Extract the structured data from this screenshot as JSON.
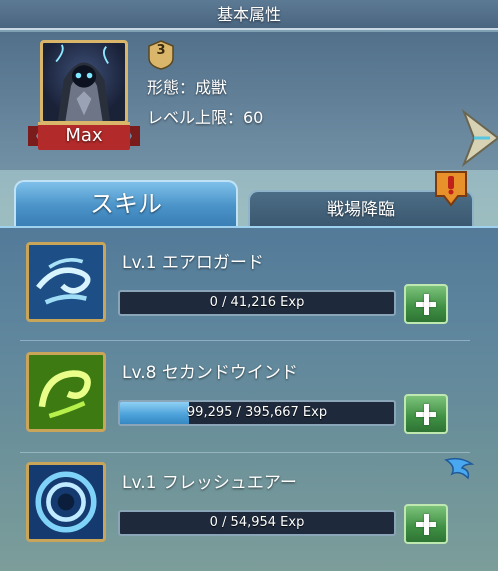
{
  "header": {
    "title": "基本属性"
  },
  "hero": {
    "level_badge": "Max",
    "rank": "3",
    "form_line": "形態：成獣",
    "level_cap_line": "レベル上限：60"
  },
  "tabs": [
    {
      "label": "スキル",
      "active": true
    },
    {
      "label": "戦場降臨",
      "active": false
    }
  ],
  "skills": [
    {
      "name": "Lv.1 エアロガード",
      "exp_text": "0 / 41,216 Exp",
      "exp_fraction": 0,
      "icon": "wind-swirl-icon"
    },
    {
      "name": "Lv.8 セカンドウインド",
      "exp_text": "99,295 / 395,667 Exp",
      "exp_fraction": 0.251,
      "icon": "green-wind-icon"
    },
    {
      "name": "Lv.1 フレッシュエアー",
      "exp_text": "0 / 54,954 Exp",
      "exp_fraction": 0,
      "icon": "air-vortex-icon"
    }
  ],
  "colors": {
    "accent_blue": "#4a93c8",
    "plus_green": "#3e8f43",
    "gold_frame": "#c9a55a"
  }
}
